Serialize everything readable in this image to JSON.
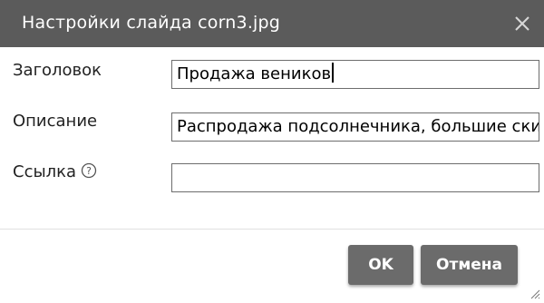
{
  "dialog": {
    "title": "Настройки слайда corn3.jpg",
    "close_icon": "close-icon"
  },
  "fields": {
    "title_label": "Заголовок",
    "title_value": "Продажа веников",
    "description_label": "Описание",
    "description_value": "Распродажа подсолнечника, большие скидки",
    "link_label": "Ссылка",
    "link_value": "",
    "help_icon": "question-circle-icon"
  },
  "buttons": {
    "ok_label": "OK",
    "cancel_label": "Отмена"
  },
  "colors": {
    "titlebar": "#5b5b5b",
    "button": "#6b6b6b",
    "field_border": "#6d6d6d"
  }
}
